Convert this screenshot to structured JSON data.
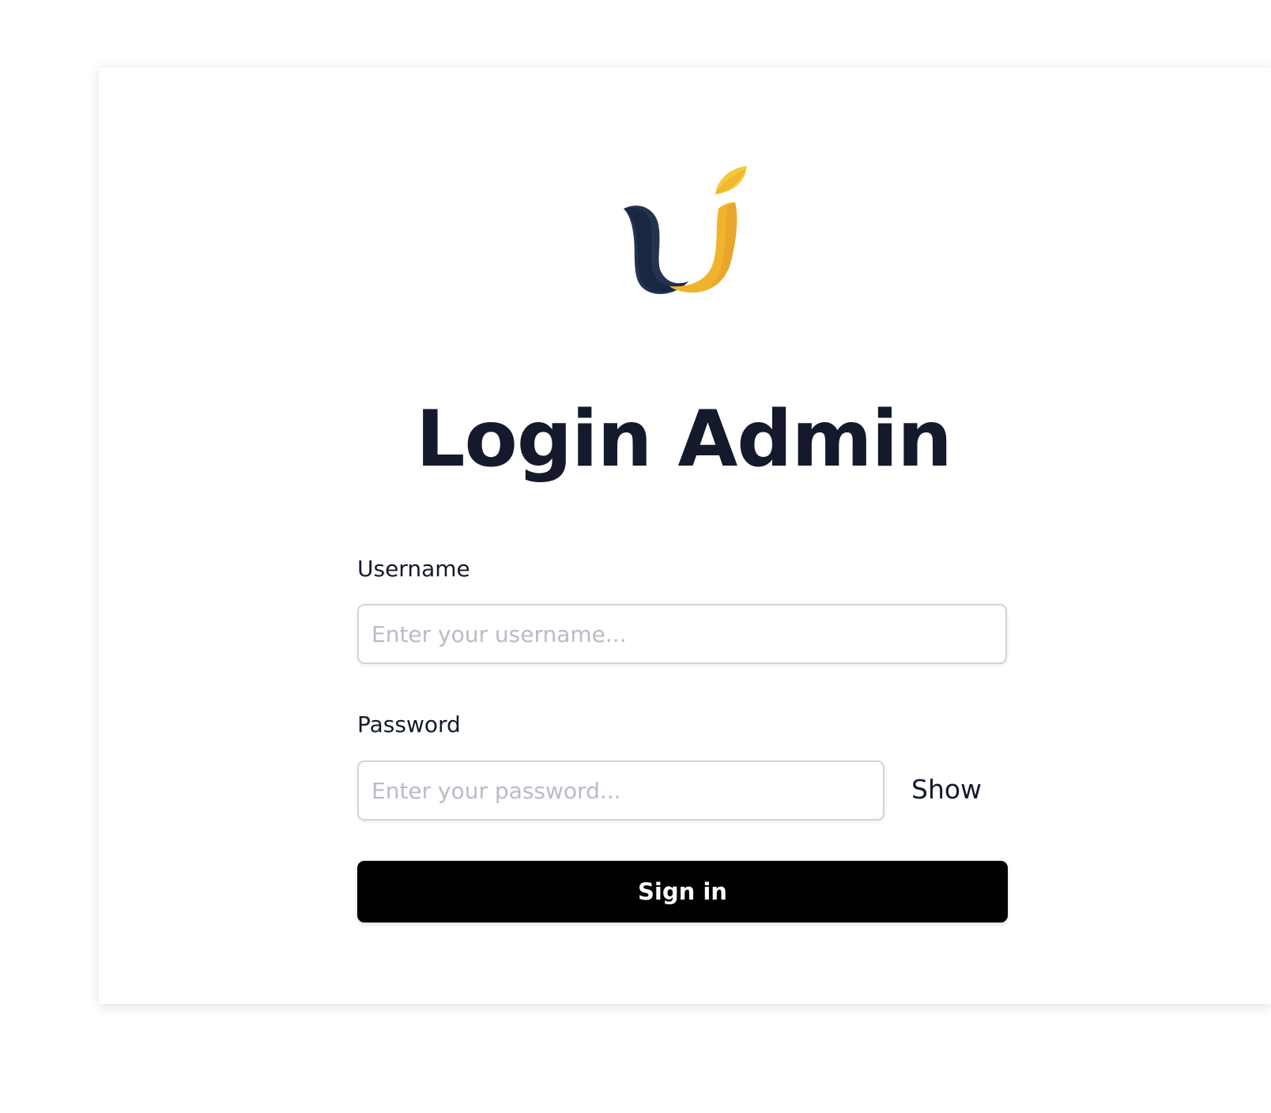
{
  "page": {
    "title": "Login Admin"
  },
  "logo": {
    "icon": "brand-logo-icon",
    "colors": {
      "navy": "#233453",
      "navy_dark": "#1a2740",
      "gold": "#f0b32e",
      "gold_light": "#f4c93f"
    }
  },
  "form": {
    "username": {
      "label": "Username",
      "placeholder": "Enter your username...",
      "value": ""
    },
    "password": {
      "label": "Password",
      "placeholder": "Enter your password...",
      "value": "",
      "toggle_label": "Show"
    },
    "submit_label": "Sign in"
  },
  "colors": {
    "text": "#141a2c",
    "button_bg": "#000000",
    "button_text": "#ffffff",
    "input_border": "#d4d4d4",
    "placeholder": "#b8bcc6"
  }
}
